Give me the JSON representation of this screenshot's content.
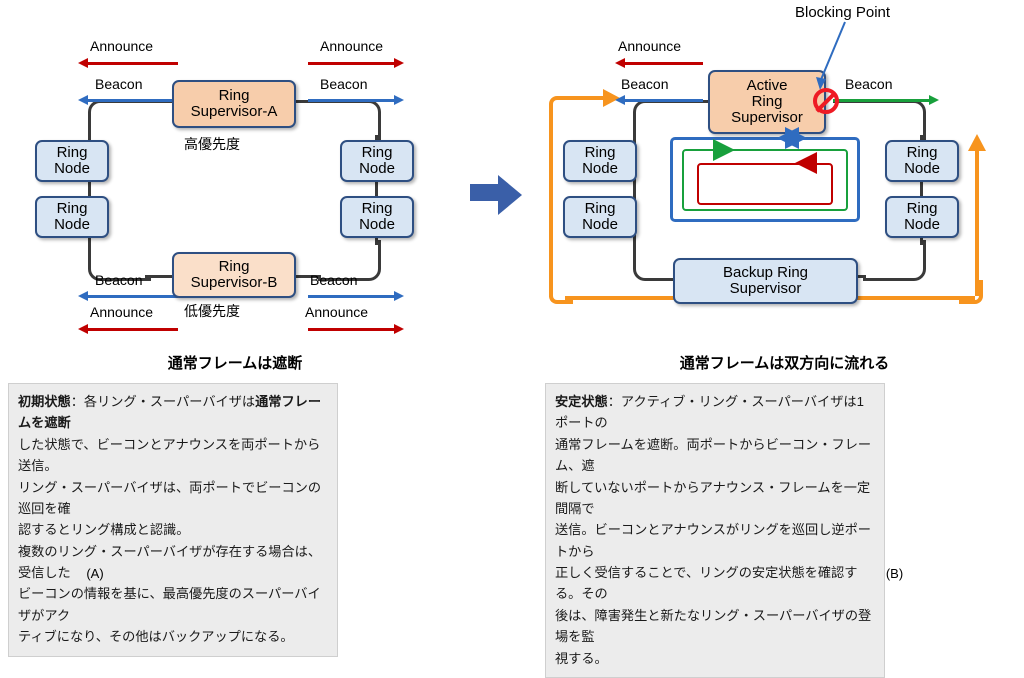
{
  "panels": {
    "a": {
      "caption": "(A)",
      "heading": "通常フレームは遮断",
      "supervisor_top": {
        "line1": "Ring",
        "line2": "Supervisor-A"
      },
      "supervisor_bottom": {
        "line1": "Ring",
        "line2": "Supervisor-B"
      },
      "priority_top": "高優先度",
      "priority_bottom": "低優先度",
      "node_label": {
        "line1": "Ring",
        "line2": "Node"
      },
      "signals": {
        "announce": "Announce",
        "beacon": "Beacon"
      },
      "text": {
        "l1_bold_a": "初期状態",
        "l1_rest": "：各リング・スーパーバイザは",
        "l1_bold_b": "通常フレームを遮断",
        "l2": "した状態で、ビーコンとアナウンスを両ポートから送信。",
        "l3": "リング・スーパーバイザは、両ポートでビーコンの巡回を確",
        "l4": "認するとリング構成と認識。",
        "l5": "複数のリング・スーパーバイザが存在する場合は、受信した",
        "l6": "ビーコンの情報を基に、最高優先度のスーパーバイザがアク",
        "l7": "ティブになり、その他はバックアップになる。"
      }
    },
    "b": {
      "caption": "(B)",
      "heading": "通常フレームは双方向に流れる",
      "active_supervisor": {
        "line1": "Active",
        "line2": "Ring",
        "line3": "Supervisor"
      },
      "backup_supervisor": {
        "line1": "Backup Ring",
        "line2": "Supervisor"
      },
      "node_label": {
        "line1": "Ring",
        "line2": "Node"
      },
      "blocking_point_label": "Blocking Point",
      "signals": {
        "announce": "Announce",
        "beacon_left": "Beacon",
        "beacon_right": "Beacon"
      },
      "text": {
        "l1_bold": "安定状態",
        "l1_rest": "：アクティブ・リング・スーパーバイザは1ポートの",
        "l2": "通常フレームを遮断。両ポートからビーコン・フレーム、遮",
        "l3": "断していないポートからアナウンス・フレームを一定間隔で",
        "l4": "送信。ビーコンとアナウンスがリングを巡回し逆ポートから",
        "l5": "正しく受信することで、リングの安定状態を確認する。その",
        "l6": "後は、障害発生と新たなリング・スーパーバイザの登場を監",
        "l7": "視する。"
      }
    }
  },
  "colors": {
    "announce_red": "#c00000",
    "beacon_blue": "#2f6cc0",
    "beacon_green": "#18a03c",
    "orange_path": "#f7941e",
    "blocking_red": "#ee1b24",
    "node_fill": "#d8e5f3",
    "supervisor_fill": "#f7cdab",
    "node_border": "#2e4f82",
    "transition_arrow": "#3a5fa8",
    "textbox_bg": "#ececec"
  }
}
